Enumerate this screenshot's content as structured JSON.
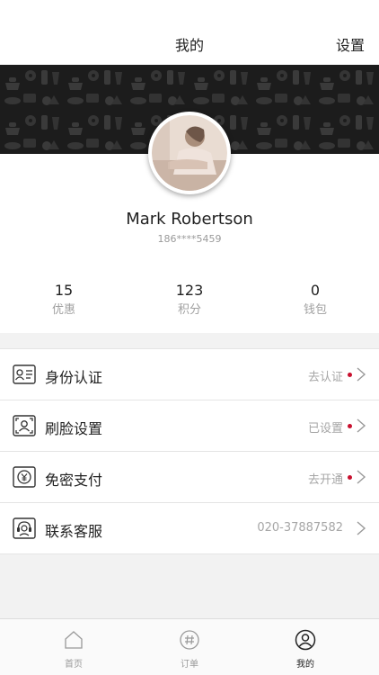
{
  "header": {
    "title": "我的",
    "settings_label": "设置"
  },
  "profile": {
    "name": "Mark Robertson",
    "phone": "186****5459"
  },
  "stats": [
    {
      "value": "15",
      "label": "优惠"
    },
    {
      "value": "123",
      "label": "积分"
    },
    {
      "value": "0",
      "label": "钱包"
    }
  ],
  "menu": [
    {
      "label": "身份认证",
      "value": "去认证",
      "icon": "id-card-icon",
      "dot": true
    },
    {
      "label": "刷脸设置",
      "value": "已设置",
      "icon": "face-scan-icon",
      "dot": true
    },
    {
      "label": "免密支付",
      "value": "去开通",
      "icon": "yuan-pay-icon",
      "dot": true
    },
    {
      "label": "联系客服",
      "value": "020-37887582",
      "icon": "customer-service-icon",
      "dot": false
    }
  ],
  "tabbar": [
    {
      "label": "首页",
      "icon": "home-icon",
      "active": false
    },
    {
      "label": "订单",
      "icon": "order-icon",
      "active": false
    },
    {
      "label": "我的",
      "icon": "profile-icon",
      "active": true
    }
  ],
  "colors": {
    "accent_dot": "#c8102e",
    "banner": "#1c1c1c"
  }
}
